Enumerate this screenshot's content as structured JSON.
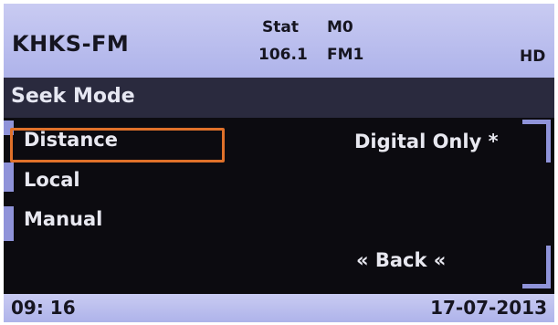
{
  "header": {
    "station_name": "KHKS-FM",
    "stat_label": "Stat",
    "memory": "M0",
    "frequency": "106.1",
    "band": "FM1",
    "hd_indicator": "HD"
  },
  "title_bar": {
    "title": "Seek Mode"
  },
  "menu": {
    "items": [
      {
        "label": "Distance",
        "selected": true
      },
      {
        "label": "Local",
        "selected": false
      },
      {
        "label": "Manual",
        "selected": false
      }
    ],
    "current_value": "Digital Only *",
    "back_label": "« Back «"
  },
  "status_bar": {
    "time": "09: 16",
    "date": "17-07-2013"
  },
  "colors": {
    "header_bg": "#b8bcee",
    "content_bg": "#0c0b10",
    "selection_border": "#e0712a",
    "scroll_indicator": "#8f93d9"
  }
}
